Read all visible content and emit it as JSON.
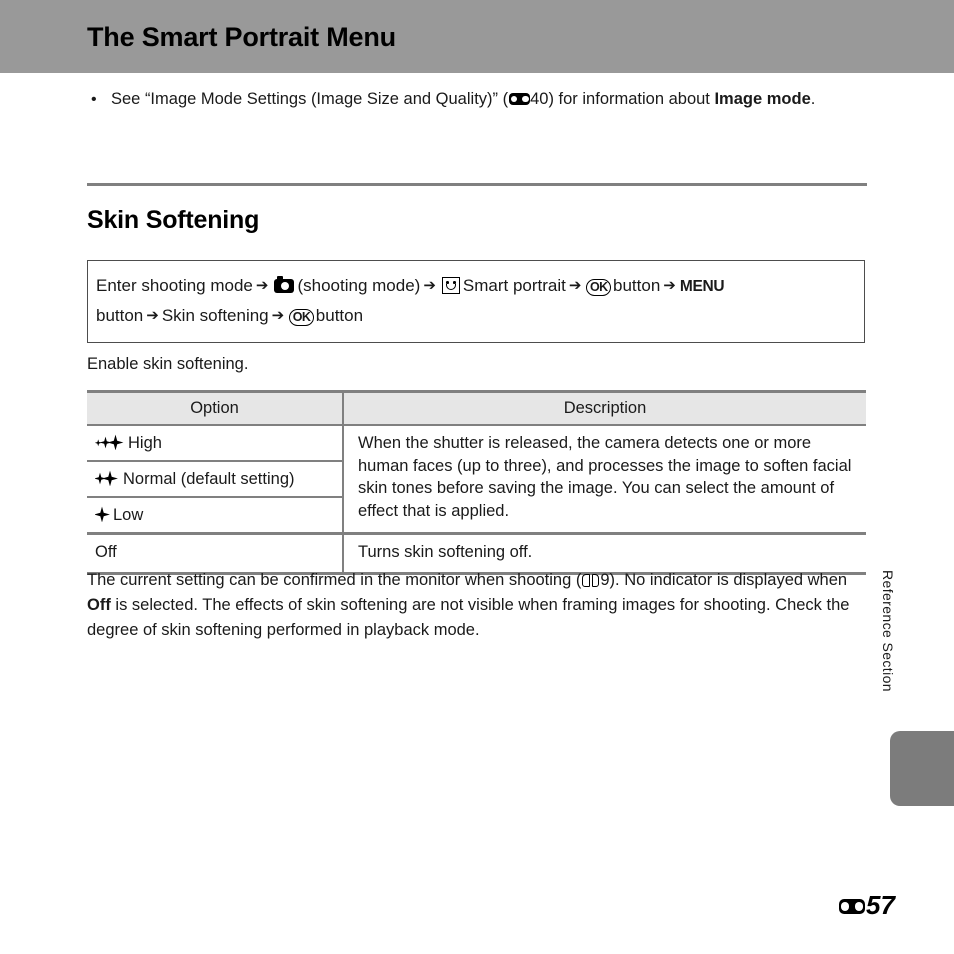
{
  "header": {
    "title": "The Smart Portrait Menu",
    "band_color": "#999999"
  },
  "bullet": {
    "marker": "•",
    "text_before": "See “Image Mode Settings (Image Size and Quality)” (",
    "ref_icon": "reference-section-icon",
    "ref_page": "40",
    "text_mid": ") for information about ",
    "bold_part": "Image mode",
    "text_after": "."
  },
  "section": {
    "heading": "Skin Softening",
    "intro": "Enable skin softening."
  },
  "nav_path": {
    "line1": {
      "t1": "Enter shooting mode",
      "arrow": "➔",
      "camera_icon": "camera-icon",
      "t2": "(shooting mode)",
      "smile_icon": "smart-portrait-icon",
      "t3": "Smart portrait",
      "ok_icon": "OK",
      "t4": "button",
      "menu_icon": "MENU"
    },
    "line2": {
      "t1": "button",
      "arrow": "➔",
      "t2": "Skin softening",
      "ok_icon": "OK",
      "t3": "button"
    }
  },
  "table": {
    "headers": {
      "option": "Option",
      "description": "Description"
    },
    "rows": [
      {
        "icon": "sparkle-triple-icon",
        "sparkles": 3,
        "label": "High",
        "description": "When the shutter is released, the camera detects one or more human faces (up to three), and processes the image to soften facial skin tones before saving the image. You can select the amount of effect that is applied.",
        "description_rowspan": 3
      },
      {
        "icon": "sparkle-double-icon",
        "sparkles": 2,
        "label": "Normal (default setting)"
      },
      {
        "icon": "sparkle-single-icon",
        "sparkles": 1,
        "label": "Low"
      },
      {
        "icon": null,
        "sparkles": 0,
        "label": "Off",
        "description": "Turns skin softening off."
      }
    ]
  },
  "closing": {
    "t1": "The current setting can be confirmed in the monitor when shooting (",
    "book_icon": "open-book-icon",
    "ref_page": "9",
    "t2": "). No indicator is displayed when ",
    "bold_part": "Off",
    "t3": " is selected. The effects of skin softening are not visible when framing images for shooting. Check the degree of skin softening performed in playback mode."
  },
  "side": {
    "section_label": "Reference Section",
    "tab_color": "#7c7c7c"
  },
  "page_number": {
    "prefix_icon": "reference-section-icon",
    "value": "57"
  }
}
